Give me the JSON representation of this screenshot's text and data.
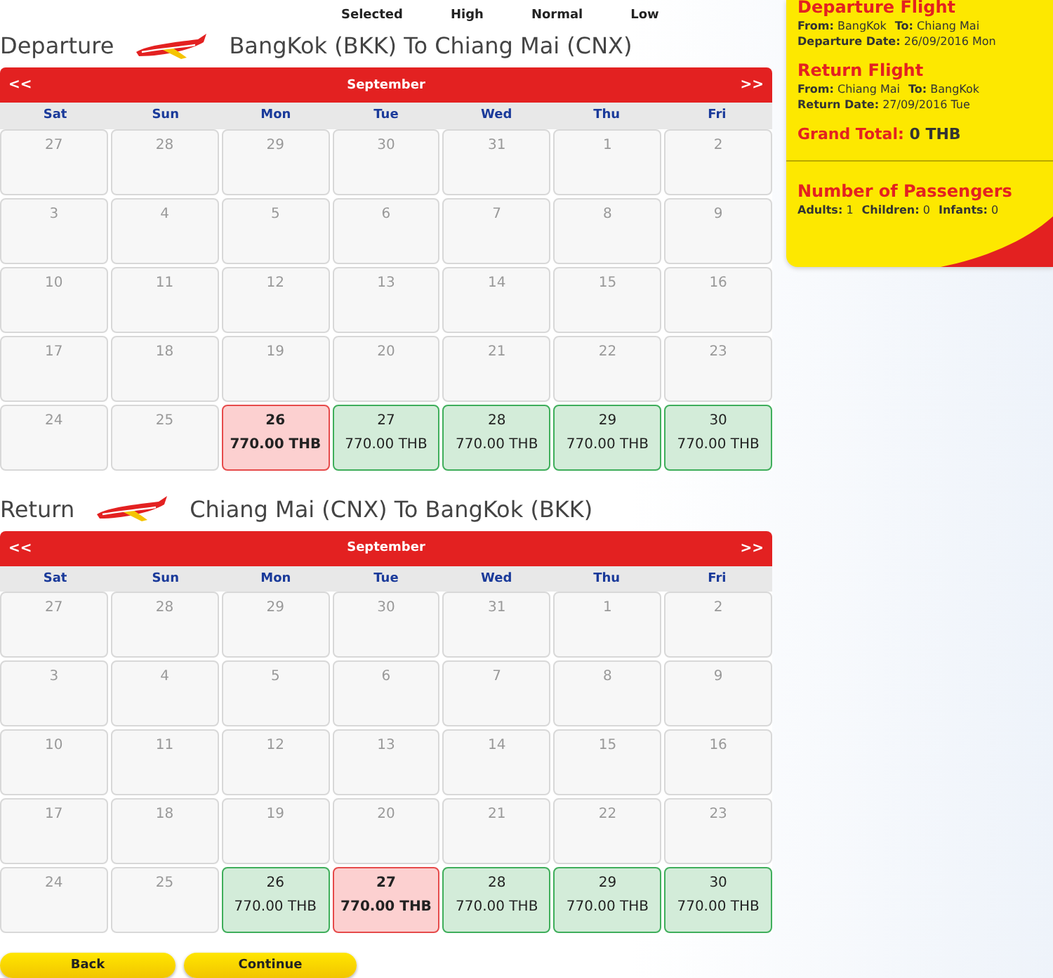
{
  "legend": [
    "Selected",
    "High",
    "Normal",
    "Low"
  ],
  "calendars": [
    {
      "label": "Departure",
      "route": "BangKok (BKK) To Chiang Mai (CNX)",
      "prev": "<<",
      "month": "September",
      "next": ">>",
      "weekdays": [
        "Sat",
        "Sun",
        "Mon",
        "Tue",
        "Wed",
        "Thu",
        "Fri"
      ],
      "days": [
        {
          "day": "27"
        },
        {
          "day": "28"
        },
        {
          "day": "29"
        },
        {
          "day": "30"
        },
        {
          "day": "31"
        },
        {
          "day": "1"
        },
        {
          "day": "2"
        },
        {
          "day": "3"
        },
        {
          "day": "4"
        },
        {
          "day": "5"
        },
        {
          "day": "6"
        },
        {
          "day": "7"
        },
        {
          "day": "8"
        },
        {
          "day": "9"
        },
        {
          "day": "10"
        },
        {
          "day": "11"
        },
        {
          "day": "12"
        },
        {
          "day": "13"
        },
        {
          "day": "14"
        },
        {
          "day": "15"
        },
        {
          "day": "16"
        },
        {
          "day": "17"
        },
        {
          "day": "18"
        },
        {
          "day": "19"
        },
        {
          "day": "20"
        },
        {
          "day": "21"
        },
        {
          "day": "22"
        },
        {
          "day": "23"
        },
        {
          "day": "24"
        },
        {
          "day": "25"
        },
        {
          "day": "26",
          "price": "770.00 THB",
          "selected": true
        },
        {
          "day": "27",
          "price": "770.00 THB",
          "selected": false
        },
        {
          "day": "28",
          "price": "770.00 THB",
          "selected": false
        },
        {
          "day": "29",
          "price": "770.00 THB",
          "selected": false
        },
        {
          "day": "30",
          "price": "770.00 THB",
          "selected": false
        }
      ]
    },
    {
      "label": "Return",
      "route": "Chiang Mai (CNX) To BangKok (BKK)",
      "prev": "<<",
      "month": "September",
      "next": ">>",
      "weekdays": [
        "Sat",
        "Sun",
        "Mon",
        "Tue",
        "Wed",
        "Thu",
        "Fri"
      ],
      "days": [
        {
          "day": "27"
        },
        {
          "day": "28"
        },
        {
          "day": "29"
        },
        {
          "day": "30"
        },
        {
          "day": "31"
        },
        {
          "day": "1"
        },
        {
          "day": "2"
        },
        {
          "day": "3"
        },
        {
          "day": "4"
        },
        {
          "day": "5"
        },
        {
          "day": "6"
        },
        {
          "day": "7"
        },
        {
          "day": "8"
        },
        {
          "day": "9"
        },
        {
          "day": "10"
        },
        {
          "day": "11"
        },
        {
          "day": "12"
        },
        {
          "day": "13"
        },
        {
          "day": "14"
        },
        {
          "day": "15"
        },
        {
          "day": "16"
        },
        {
          "day": "17"
        },
        {
          "day": "18"
        },
        {
          "day": "19"
        },
        {
          "day": "20"
        },
        {
          "day": "21"
        },
        {
          "day": "22"
        },
        {
          "day": "23"
        },
        {
          "day": "24"
        },
        {
          "day": "25"
        },
        {
          "day": "26",
          "price": "770.00 THB",
          "selected": false
        },
        {
          "day": "27",
          "price": "770.00 THB",
          "selected": true
        },
        {
          "day": "28",
          "price": "770.00 THB",
          "selected": false
        },
        {
          "day": "29",
          "price": "770.00 THB",
          "selected": false
        },
        {
          "day": "30",
          "price": "770.00 THB",
          "selected": false
        }
      ]
    }
  ],
  "buttons": [
    "Back",
    "Continue"
  ],
  "summary": {
    "departure": {
      "title": "Departure Flight",
      "lines": [
        [
          {
            "label": "From:",
            "value": "BangKok"
          },
          {
            "label": "To:",
            "value": "Chiang Mai"
          }
        ],
        [
          {
            "label": "Departure Date:",
            "value": "26/09/2016 Mon"
          }
        ]
      ]
    },
    "return": {
      "title": "Return Flight",
      "lines": [
        [
          {
            "label": "From:",
            "value": "Chiang Mai"
          },
          {
            "label": "To:",
            "value": "BangKok"
          }
        ],
        [
          {
            "label": "Return Date:",
            "value": "27/09/2016 Tue"
          }
        ]
      ]
    },
    "total": {
      "label": "Grand Total:",
      "value": "0 THB"
    },
    "passengers": {
      "title": "Number of Passengers",
      "items": [
        {
          "label": "Adults:",
          "value": "1"
        },
        {
          "label": "Children:",
          "value": "0"
        },
        {
          "label": "Infants:",
          "value": "0"
        }
      ]
    }
  }
}
